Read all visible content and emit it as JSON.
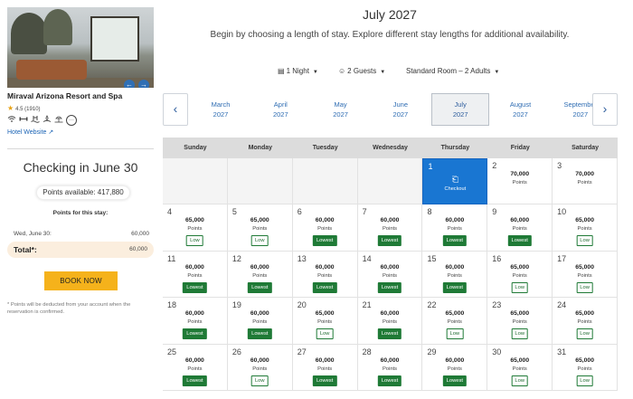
{
  "hotel": {
    "name": "Miraval Arizona Resort and Spa",
    "rating": "4.5 (1910)",
    "website_label": "Hotel Website",
    "amenity_icons": [
      "wifi-icon",
      "fitness-icon",
      "pool-icon",
      "spa-icon",
      "beach-icon",
      "more-amenities-icon"
    ]
  },
  "booking": {
    "checkin_title": "Checking in June 30",
    "points_available": "Points available: 417,880",
    "points_for_stay_label": "Points for this stay:",
    "stay_date": "Wed, June 30:",
    "stay_points": "60,000",
    "total_label": "Total*:",
    "total_points": "60,000",
    "book_button": "BOOK NOW",
    "disclaimer": "* Points will be deducted from your account when the reservation is confirmed."
  },
  "calendar_header": {
    "title": "July 2027",
    "subtitle": "Begin by choosing a length of stay. Explore different stay lengths for additional availability."
  },
  "filters": {
    "nights": "1 Night",
    "guests": "2 Guests",
    "room": "Standard Room – 2 Adults"
  },
  "months": [
    {
      "name": "March",
      "year": "2027"
    },
    {
      "name": "April",
      "year": "2027"
    },
    {
      "name": "May",
      "year": "2027"
    },
    {
      "name": "June",
      "year": "2027"
    },
    {
      "name": "July",
      "year": "2027"
    },
    {
      "name": "August",
      "year": "2027"
    },
    {
      "name": "September",
      "year": "2027"
    }
  ],
  "selected_month_index": 4,
  "weekdays": [
    "Sunday",
    "Monday",
    "Tuesday",
    "Wednesday",
    "Thursday",
    "Friday",
    "Saturday"
  ],
  "points_unit": "Points",
  "checkout_label": "Checkout",
  "days": [
    {
      "day": "1",
      "status": "checkout"
    },
    {
      "day": "2",
      "points": "70,000",
      "badge": ""
    },
    {
      "day": "3",
      "points": "70,000",
      "badge": ""
    },
    {
      "day": "4",
      "points": "65,000",
      "badge": "Low"
    },
    {
      "day": "5",
      "points": "65,000",
      "badge": "Low"
    },
    {
      "day": "6",
      "points": "60,000",
      "badge": "Lowest"
    },
    {
      "day": "7",
      "points": "60,000",
      "badge": "Lowest"
    },
    {
      "day": "8",
      "points": "60,000",
      "badge": "Lowest"
    },
    {
      "day": "9",
      "points": "60,000",
      "badge": "Lowest"
    },
    {
      "day": "10",
      "points": "65,000",
      "badge": "Low"
    },
    {
      "day": "11",
      "points": "60,000",
      "badge": "Lowest"
    },
    {
      "day": "12",
      "points": "60,000",
      "badge": "Lowest"
    },
    {
      "day": "13",
      "points": "60,000",
      "badge": "Lowest"
    },
    {
      "day": "14",
      "points": "60,000",
      "badge": "Lowest"
    },
    {
      "day": "15",
      "points": "60,000",
      "badge": "Lowest"
    },
    {
      "day": "16",
      "points": "65,000",
      "badge": "Low"
    },
    {
      "day": "17",
      "points": "65,000",
      "badge": "Low"
    },
    {
      "day": "18",
      "points": "60,000",
      "badge": "Lowest"
    },
    {
      "day": "19",
      "points": "60,000",
      "badge": "Lowest"
    },
    {
      "day": "20",
      "points": "65,000",
      "badge": "Low"
    },
    {
      "day": "21",
      "points": "60,000",
      "badge": "Lowest"
    },
    {
      "day": "22",
      "points": "65,000",
      "badge": "Low"
    },
    {
      "day": "23",
      "points": "65,000",
      "badge": "Low"
    },
    {
      "day": "24",
      "points": "65,000",
      "badge": "Low"
    },
    {
      "day": "25",
      "points": "60,000",
      "badge": "Lowest"
    },
    {
      "day": "26",
      "points": "60,000",
      "badge": "Low"
    },
    {
      "day": "27",
      "points": "60,000",
      "badge": "Lowest"
    },
    {
      "day": "28",
      "points": "60,000",
      "badge": "Lowest"
    },
    {
      "day": "29",
      "points": "60,000",
      "badge": "Lowest"
    },
    {
      "day": "30",
      "points": "65,000",
      "badge": "Low"
    },
    {
      "day": "31",
      "points": "65,000",
      "badge": "Low"
    }
  ],
  "first_weekday_index": 4,
  "colors": {
    "accent_blue": "#1976d2",
    "lowest_green": "#1f7a36",
    "book_yellow": "#f5b21b",
    "total_bg": "#fbeede"
  }
}
